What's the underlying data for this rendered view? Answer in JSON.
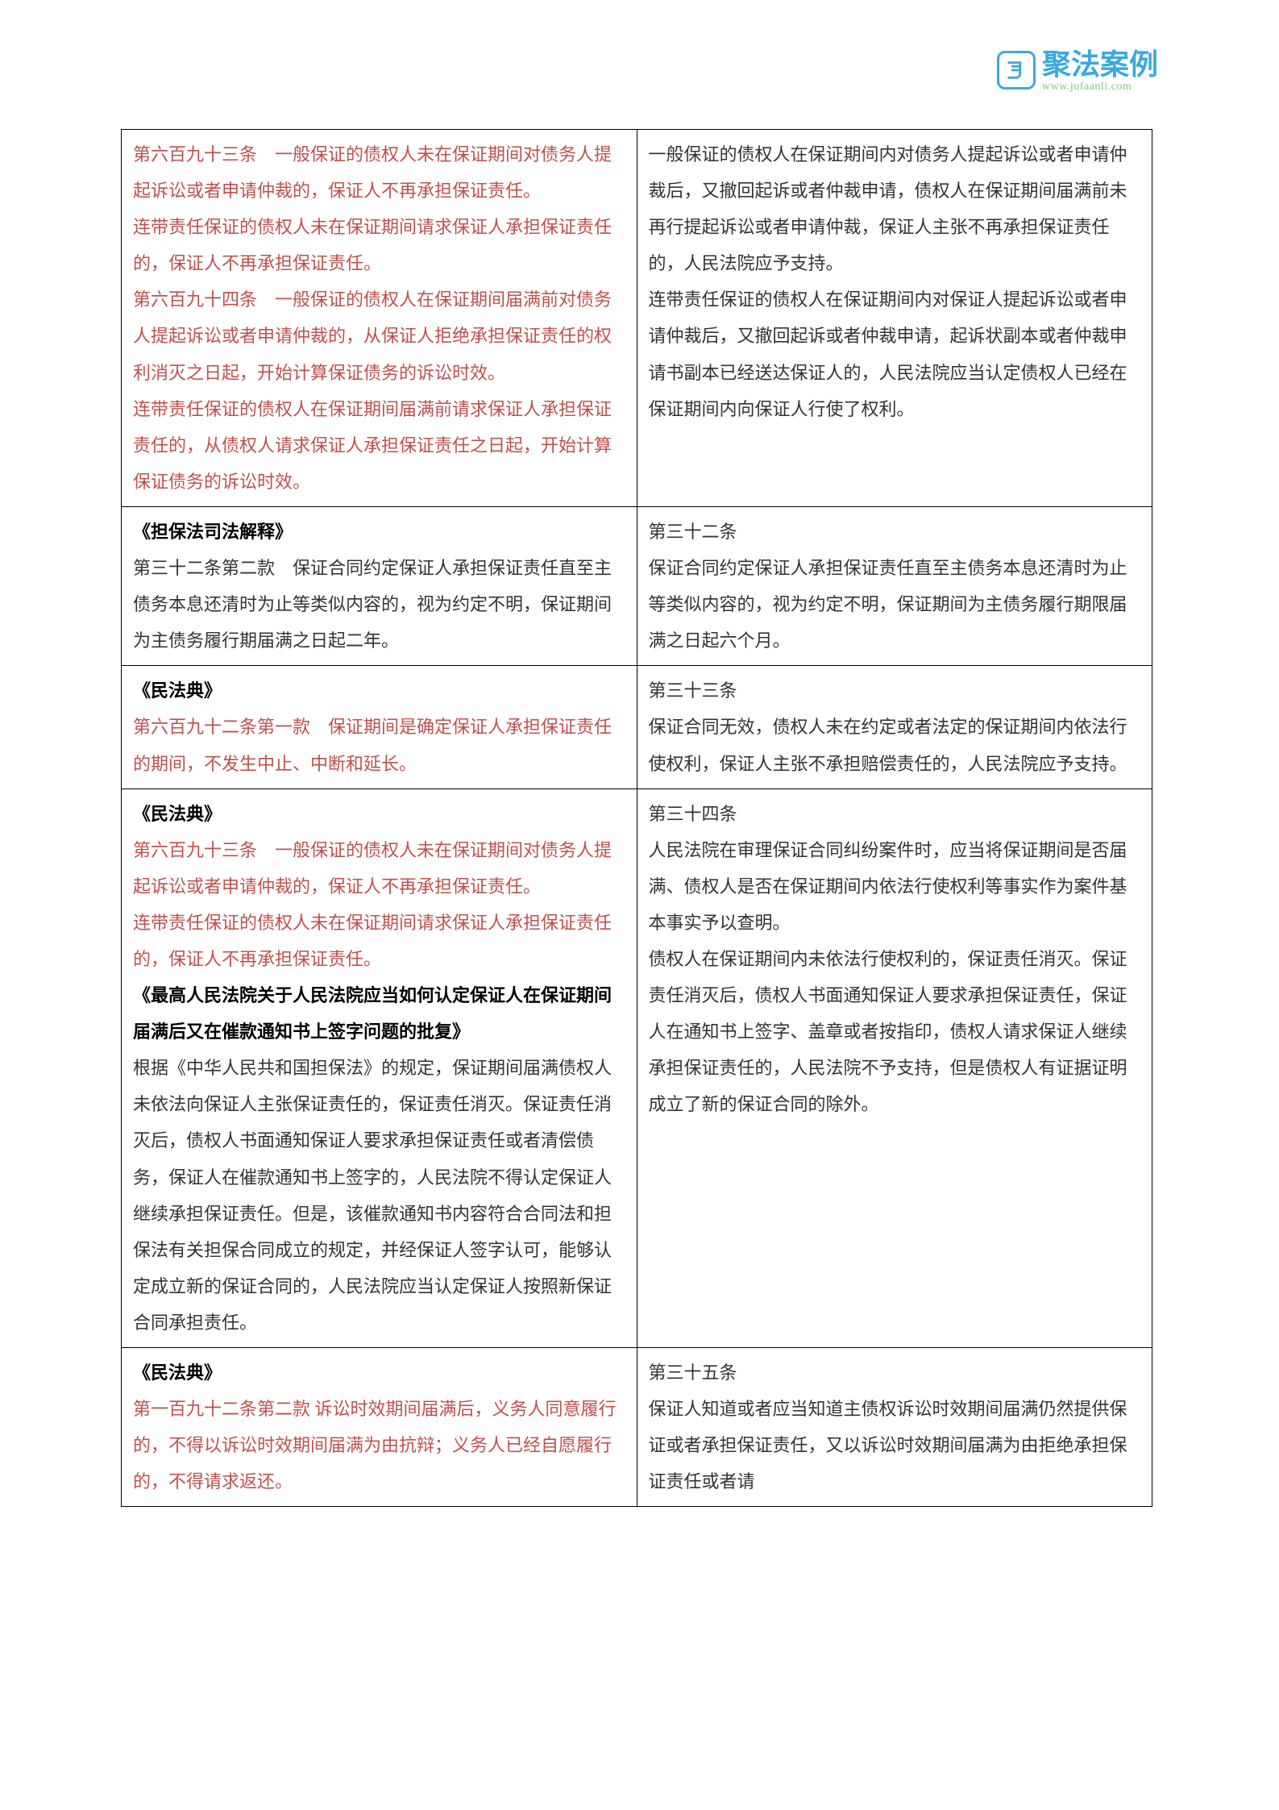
{
  "logo": {
    "cn": "聚法案例",
    "url": "www.jufaanli.com"
  },
  "rows": [
    {
      "left": [
        {
          "class": "red",
          "t": "第六百九十三条　一般保证的债权人未在保证期间对债务人提起诉讼或者申请仲裁的，保证人不再承担保证责任。"
        },
        {
          "class": "red",
          "t": "连带责任保证的债权人未在保证期间请求保证人承担保证责任的，保证人不再承担保证责任。"
        },
        {
          "class": "red",
          "t": "第六百九十四条　一般保证的债权人在保证期间届满前对债务人提起诉讼或者申请仲裁的，从保证人拒绝承担保证责任的权利消灭之日起，开始计算保证债务的诉讼时效。"
        },
        {
          "class": "red",
          "t": "连带责任保证的债权人在保证期间届满前请求保证人承担保证责任的，从债权人请求保证人承担保证责任之日起，开始计算保证债务的诉讼时效。"
        }
      ],
      "right": [
        {
          "class": "",
          "t": "一般保证的债权人在保证期间内对债务人提起诉讼或者申请仲裁后，又撤回起诉或者仲裁申请，债权人在保证期间届满前未再行提起诉讼或者申请仲裁，保证人主张不再承担保证责任的，人民法院应予支持。"
        },
        {
          "class": "",
          "t": "连带责任保证的债权人在保证期间内对保证人提起诉讼或者申请仲裁后，又撤回起诉或者仲裁申请，起诉状副本或者仲裁申请书副本已经送达保证人的，人民法院应当认定债权人已经在保证期间内向保证人行使了权利。"
        }
      ]
    },
    {
      "left": [
        {
          "class": "bold",
          "t": "《担保法司法解释》"
        },
        {
          "class": "",
          "t": "第三十二条第二款　保证合同约定保证人承担保证责任直至主债务本息还清时为止等类似内容的，视为约定不明，保证期间为主债务履行期届满之日起二年。"
        }
      ],
      "right": [
        {
          "class": "",
          "t": "第三十二条"
        },
        {
          "class": "",
          "t": "保证合同约定保证人承担保证责任直至主债务本息还清时为止等类似内容的，视为约定不明，保证期间为主债务履行期限届满之日起六个月。"
        }
      ]
    },
    {
      "left": [
        {
          "class": "red bold",
          "t": "《民法典》"
        },
        {
          "class": "red",
          "t": "第六百九十二条第一款　保证期间是确定保证人承担保证责任的期间，不发生中止、中断和延长。"
        }
      ],
      "right": [
        {
          "class": "",
          "t": "第三十三条"
        },
        {
          "class": "",
          "t": "保证合同无效，债权人未在约定或者法定的保证期间内依法行使权利，保证人主张不承担赔偿责任的，人民法院应予支持。"
        }
      ]
    },
    {
      "left": [
        {
          "class": "red bold",
          "t": "《民法典》"
        },
        {
          "class": "red",
          "t": "第六百九十三条　一般保证的债权人未在保证期间对债务人提起诉讼或者申请仲裁的，保证人不再承担保证责任。"
        },
        {
          "class": "red",
          "t": "连带责任保证的债权人未在保证期间请求保证人承担保证责任的，保证人不再承担保证责任。"
        },
        {
          "class": "bold",
          "t": "《最高人民法院关于人民法院应当如何认定保证人在保证期间届满后又在催款通知书上签字问题的批复》"
        },
        {
          "class": "",
          "t": "根据《中华人民共和国担保法》的规定，保证期间届满债权人未依法向保证人主张保证责任的，保证责任消灭。保证责任消灭后，债权人书面通知保证人要求承担保证责任或者清偿债务，保证人在催款通知书上签字的，人民法院不得认定保证人继续承担保证责任。但是，该催款通知书内容符合合同法和担保法有关担保合同成立的规定，并经保证人签字认可，能够认定成立新的保证合同的，人民法院应当认定保证人按照新保证合同承担责任。"
        }
      ],
      "right": [
        {
          "class": "",
          "t": "第三十四条"
        },
        {
          "class": "",
          "t": "人民法院在审理保证合同纠纷案件时，应当将保证期间是否届满、债权人是否在保证期间内依法行使权利等事实作为案件基本事实予以查明。"
        },
        {
          "class": "",
          "t": "债权人在保证期间内未依法行使权利的，保证责任消灭。保证责任消灭后，债权人书面通知保证人要求承担保证责任，保证人在通知书上签字、盖章或者按指印，债权人请求保证人继续承担保证责任的，人民法院不予支持，但是债权人有证据证明成立了新的保证合同的除外。"
        }
      ]
    },
    {
      "left": [
        {
          "class": "red bold",
          "t": "《民法典》"
        },
        {
          "class": "red",
          "t": "第一百九十二条第二款 诉讼时效期间届满后，义务人同意履行的，不得以诉讼时效期间届满为由抗辩；义务人已经自愿履行的，不得请求返还。"
        }
      ],
      "right": [
        {
          "class": "",
          "t": "第三十五条"
        },
        {
          "class": "",
          "t": "保证人知道或者应当知道主债权诉讼时效期间届满仍然提供保证或者承担保证责任，又以诉讼时效期间届满为由拒绝承担保证责任或者请"
        }
      ]
    }
  ]
}
